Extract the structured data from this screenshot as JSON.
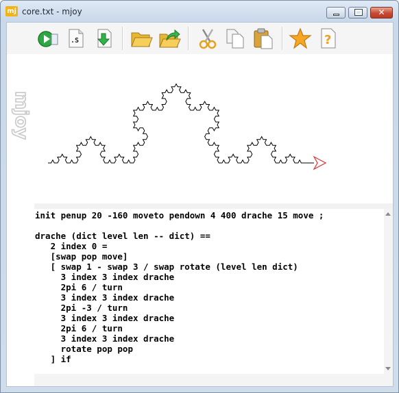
{
  "window": {
    "app_icon": "mj",
    "title": "core.txt - mjoy"
  },
  "toolbar": {
    "icons": [
      "run-icon",
      "script-icon",
      "download-icon",
      "open-folder-icon",
      "export-folder-icon",
      "cut-icon",
      "copy-icon",
      "paste-icon",
      "favorite-star-icon",
      "help-icon"
    ],
    "script_icon_label": ".S",
    "help_icon_glyph": "?"
  },
  "sidebar": {
    "logo": "mjoy"
  },
  "colors": {
    "arrow_red": "#e03030",
    "star": "#f5a623",
    "run_green": "#2ea844"
  },
  "editor": {
    "lines": [
      "init penup 20 -160 moveto pendown 4 400 drache 15 move ;",
      "",
      "drache (dict level len -- dict) ==",
      "   2 index 0 =",
      "   [swap pop move]",
      "   [ swap 1 - swap 3 / swap rotate (level len dict)",
      "     3 index 3 index drache",
      "     2pi 6 / turn",
      "     3 index 3 index drache",
      "     2pi -3 / turn",
      "     3 index 3 index drache",
      "     2pi 6 / turn",
      "     3 index 3 index drache",
      "     rotate pop pop",
      "   ] if"
    ]
  }
}
